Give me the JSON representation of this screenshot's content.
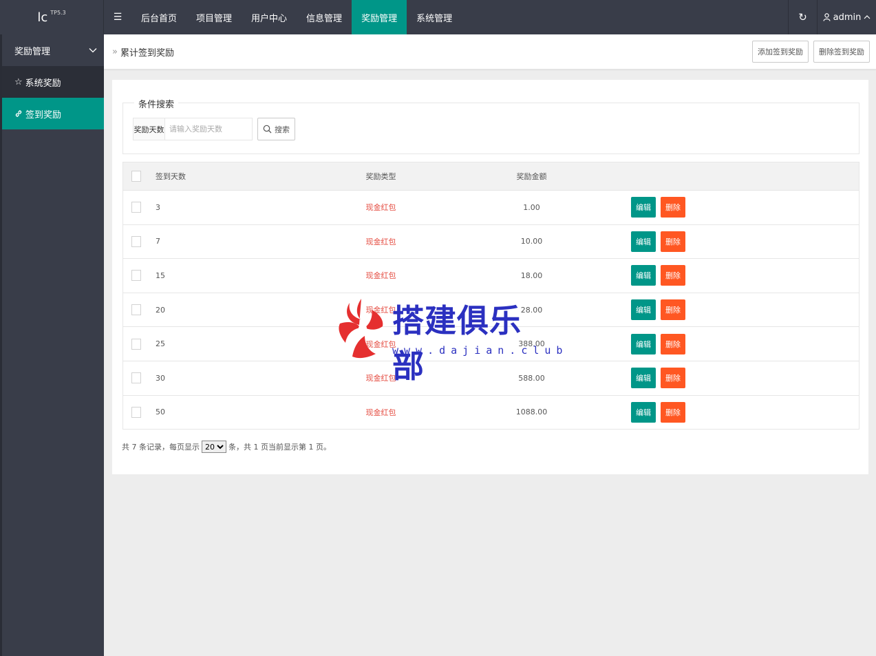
{
  "topbar": {
    "logo": "lc",
    "logo_sup": "TP5.3",
    "menu_toggle_icon": "hamburger-icon",
    "nav": [
      {
        "label": "后台首页",
        "active": false
      },
      {
        "label": "项目管理",
        "active": false
      },
      {
        "label": "用户中心",
        "active": false
      },
      {
        "label": "信息管理",
        "active": false
      },
      {
        "label": "奖励管理",
        "active": true
      },
      {
        "label": "系统管理",
        "active": false
      }
    ],
    "user": "admin"
  },
  "sidebar": {
    "group": "奖励管理",
    "items": [
      {
        "label": "系统奖励",
        "icon": "star-icon",
        "active": false
      },
      {
        "label": "签到奖励",
        "icon": "link-icon",
        "active": true
      }
    ]
  },
  "breadcrumb": {
    "title": "累计签到奖励",
    "add_button": "添加签到奖励",
    "delete_button": "删除签到奖励"
  },
  "search": {
    "legend": "条件搜索",
    "field_label": "奖励天数",
    "placeholder": "请输入奖励天数",
    "value": "",
    "button": "搜索"
  },
  "table": {
    "headers": {
      "days": "签到天数",
      "type": "奖励类型",
      "amount": "奖励金额"
    },
    "rows": [
      {
        "days": "3",
        "type": "现金红包",
        "amount": "1.00"
      },
      {
        "days": "7",
        "type": "现金红包",
        "amount": "10.00"
      },
      {
        "days": "15",
        "type": "现金红包",
        "amount": "18.00"
      },
      {
        "days": "20",
        "type": "现金红包",
        "amount": "28.00"
      },
      {
        "days": "25",
        "type": "现金红包",
        "amount": "388.00"
      },
      {
        "days": "30",
        "type": "现金红包",
        "amount": "588.00"
      },
      {
        "days": "50",
        "type": "现金红包",
        "amount": "1088.00"
      }
    ],
    "edit_label": "编辑",
    "delete_label": "删除"
  },
  "pager": {
    "prefix": "共 7 条记录，每页显示",
    "page_size": "20",
    "suffix": "条，共 1 页当前显示第 1 页。"
  },
  "watermark": {
    "text": "搭建俱乐部",
    "url": "www.dajian.club"
  },
  "colors": {
    "topbar": "#393d49",
    "accent": "#009688",
    "danger": "#ff5722",
    "type_text": "#e54d42"
  }
}
